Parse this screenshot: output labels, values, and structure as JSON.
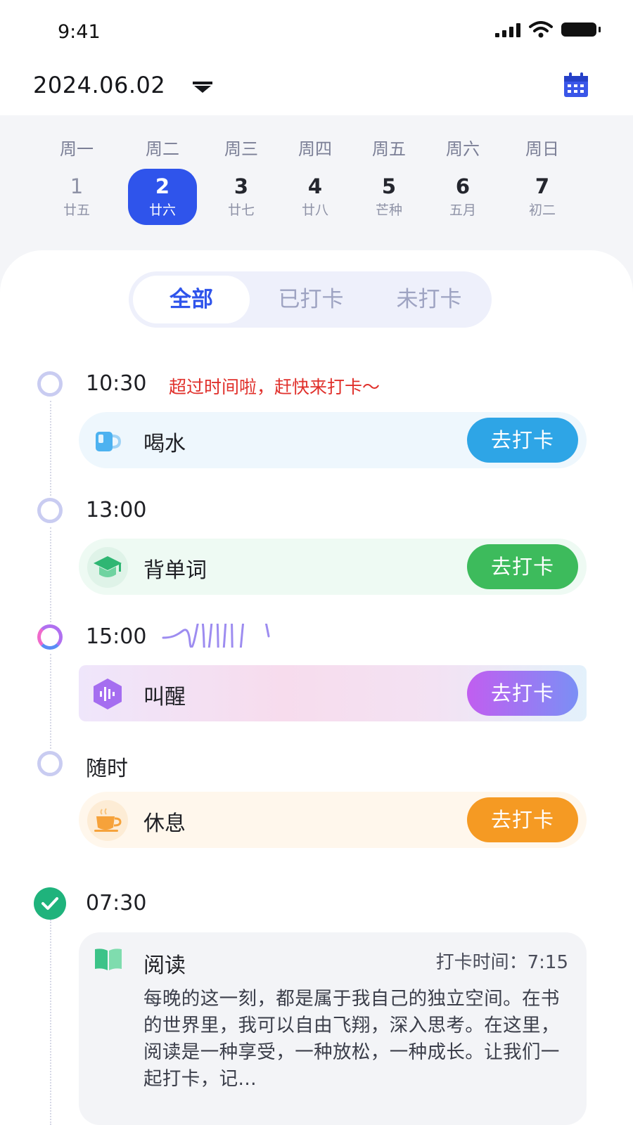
{
  "status_bar": {
    "time": "9:41"
  },
  "header": {
    "date": "2024.06.02"
  },
  "week": [
    {
      "name": "周一",
      "day": "1",
      "lunar": "廿五"
    },
    {
      "name": "周二",
      "day": "2",
      "lunar": "廿六"
    },
    {
      "name": "周三",
      "day": "3",
      "lunar": "廿七"
    },
    {
      "name": "周四",
      "day": "4",
      "lunar": "廿八"
    },
    {
      "name": "周五",
      "day": "5",
      "lunar": "芒种"
    },
    {
      "name": "周六",
      "day": "6",
      "lunar": "五月"
    },
    {
      "name": "周日",
      "day": "7",
      "lunar": "初二"
    }
  ],
  "selected_day": "2",
  "filter_tabs": [
    "全部",
    "已打卡",
    "未打卡"
  ],
  "active_filter": "全部",
  "tasks": [
    {
      "time": "10:30",
      "warning": "超过时间啦，赶快来打卡～",
      "name": "喝水",
      "action": "去打卡",
      "icon": "cup-icon",
      "color": "#2ea5e6"
    },
    {
      "time": "13:00",
      "name": "背单词",
      "action": "去打卡",
      "icon": "graduation-cap-icon",
      "color": "#3dbb5c"
    },
    {
      "time": "15:00",
      "name": "叫醒",
      "action": "去打卡",
      "icon": "sound-wave-icon",
      "color": "#b56af0"
    },
    {
      "time": "随时",
      "name": "休息",
      "action": "去打卡",
      "icon": "coffee-icon",
      "color": "#f59a23"
    }
  ],
  "completed": {
    "time": "07:30",
    "name": "阅读",
    "icon": "book-icon",
    "checkin_time": "打卡时间：7:15",
    "note": "每晚的这一刻，都是属于我自己的独立空间。在书的世界里，我可以自由飞翔，深入思考。在这里，阅读是一种享受，一种放松，一种成长。让我们一起打卡，记..."
  }
}
